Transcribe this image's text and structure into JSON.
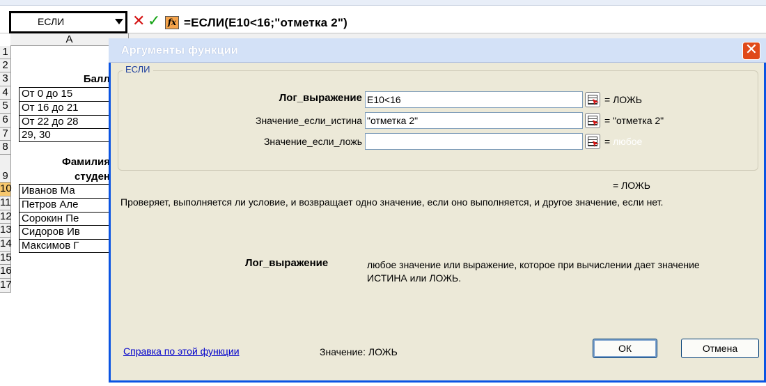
{
  "formula_bar": {
    "name_box": "ЕСЛИ",
    "cancel_glyph": "✕",
    "enter_glyph": "✓",
    "fx_glyph": "fx",
    "formula": "=ЕСЛИ(E10<16;\"отметка 2\")"
  },
  "sheet": {
    "column_header": "A",
    "row_numbers": [
      "1",
      "2",
      "3",
      "4",
      "5",
      "6",
      "7",
      "8",
      "9",
      "10",
      "11",
      "12",
      "13",
      "14",
      "15",
      "16",
      "17"
    ],
    "cells": {
      "a3": "Балл",
      "a4": "От 0 до 15",
      "a5": "От 16 до 21",
      "a6": "От 22 до 28",
      "a7": "29, 30",
      "a9_line1": "Фамилия",
      "a9_line2": "студен",
      "a10": "Иванов Ма",
      "a11": "Петров Але",
      "a12": "Сорокин Пе",
      "a13": "Сидоров Ив",
      "a14": "Максимов Г"
    }
  },
  "dialog": {
    "title": "Аргументы функции",
    "close_glyph": "✕",
    "group_label": "ЕСЛИ",
    "args": [
      {
        "label": "Лог_выражение",
        "value": "E10<16",
        "result": "= ЛОЖЬ",
        "bold": true
      },
      {
        "label": "Значение_если_истина",
        "value": "\"отметка 2\"",
        "result": "= \"отметка 2\"",
        "bold": false
      },
      {
        "label": "Значение_если_ложь",
        "value": "",
        "result_prefix": "=",
        "result_placeholder": "любое",
        "bold": false
      }
    ],
    "overall_result": "= ЛОЖЬ",
    "description": "Проверяет, выполняется ли условие, и возвращает одно значение, если оно выполняется, и другое значение, если нет.",
    "arg_help_name": "Лог_выражение",
    "arg_help_text": "любое значение или выражение, которое при вычислении дает значение ИСТИНА или ЛОЖЬ.",
    "help_link": "Справка по этой функции",
    "value_label": "Значение:",
    "value": "ЛОЖЬ",
    "ok_label": "ОК",
    "cancel_label": "Отмена"
  }
}
